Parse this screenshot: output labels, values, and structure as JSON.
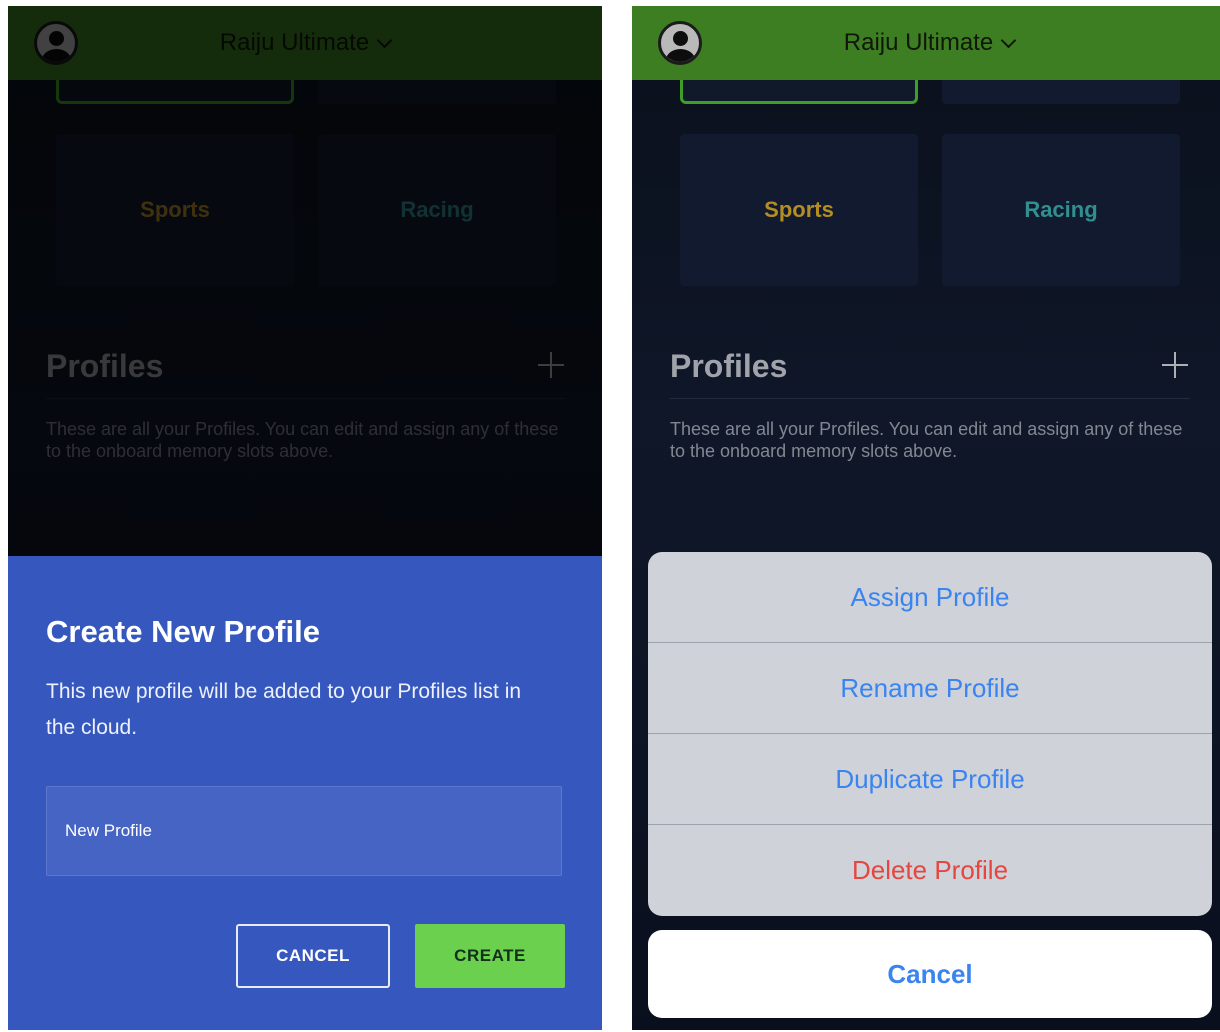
{
  "header": {
    "device_name": "Raiju Ultimate"
  },
  "tiles": {
    "sports": "Sports",
    "racing": "Racing"
  },
  "profiles": {
    "title": "Profiles",
    "description": "These are all your Profiles. You can edit and assign any of these to the onboard memory slots above."
  },
  "create_dialog": {
    "title": "Create New Profile",
    "message": "This new profile will be added to your Profiles list in the cloud.",
    "input_value": "New Profile",
    "cancel_label": "CANCEL",
    "create_label": "CREATE"
  },
  "action_sheet": {
    "items": [
      "Assign Profile",
      "Rename Profile",
      "Duplicate Profile",
      "Delete Profile"
    ],
    "cancel_label": "Cancel"
  },
  "colors": {
    "header_green": "#4e9e2c",
    "dialog_blue": "#3658be",
    "create_green": "#6ad04e",
    "sports_yellow": "#e1b12c",
    "racing_teal": "#3fb3b4",
    "ios_blue": "#3a84f1",
    "destructive_red": "#e5463f"
  },
  "icons": {
    "avatar": "user-avatar-icon",
    "dropdown": "chevron-down-icon",
    "add": "plus-icon"
  }
}
